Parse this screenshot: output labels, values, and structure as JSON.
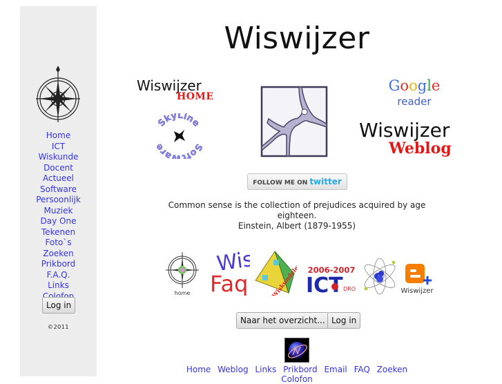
{
  "site": {
    "title": "Wiswijzer"
  },
  "sidebar": {
    "logo": "compass-rose-logo",
    "items": [
      {
        "label": "Home"
      },
      {
        "label": "ICT"
      },
      {
        "label": "Wiskunde"
      },
      {
        "label": "Docent"
      },
      {
        "label": "Actueel"
      },
      {
        "label": "Software"
      },
      {
        "label": "Persoonlijk"
      },
      {
        "label": "Muziek"
      },
      {
        "label": "Day One"
      },
      {
        "label": "Tekenen"
      },
      {
        "label": "Foto`s"
      },
      {
        "label": "Zoeken"
      },
      {
        "label": "Prikbord"
      },
      {
        "label": "F.A.Q."
      },
      {
        "label": "Links"
      },
      {
        "label": "Colofon"
      }
    ],
    "login_label": "Log in",
    "copyright": "©2011"
  },
  "banners": {
    "wiswijzer_home": {
      "word": "Wiswijzer",
      "tag": "HOME"
    },
    "skyline": {
      "top": "SkyLine",
      "bottom": "SoftWare"
    },
    "google_reader": {
      "google": "Google",
      "reader": "reader"
    },
    "wiswijzer_weblog": {
      "word": "Wiswijzer",
      "tag": "Weblog"
    }
  },
  "twitter": {
    "prefix": "FOLLOW ME ON",
    "brand": "twitter"
  },
  "quote": {
    "text": "Common sense is the collection of prejudices acquired by age eighteen.",
    "author": "Einstein, Albert (1879-1955)"
  },
  "badges": [
    {
      "name": "home",
      "caption": "home"
    },
    {
      "name": "wisfaq",
      "line1": "Wis",
      "line2": "Faq"
    },
    {
      "name": "wiskundeleraar",
      "caption": "Wiskundeleraar"
    },
    {
      "name": "ict-dro",
      "years": "2006-2007",
      "word": "ICT",
      "sub": "DRO"
    },
    {
      "name": "atom"
    },
    {
      "name": "blogger",
      "caption": "Wiswijzer"
    }
  ],
  "buttons": {
    "overview": "Naar het overzicht...",
    "login": "Log in"
  },
  "footer": {
    "links": [
      "Home",
      "Weblog",
      "Links",
      "Prikbord",
      "Email",
      "FAQ",
      "Zoeken",
      "Colofon"
    ]
  },
  "colors": {
    "link": "#3434e8",
    "sidebar_bg": "#ededed",
    "accent_red": "#e01a1a",
    "twitter_blue": "#2ba8e0"
  }
}
